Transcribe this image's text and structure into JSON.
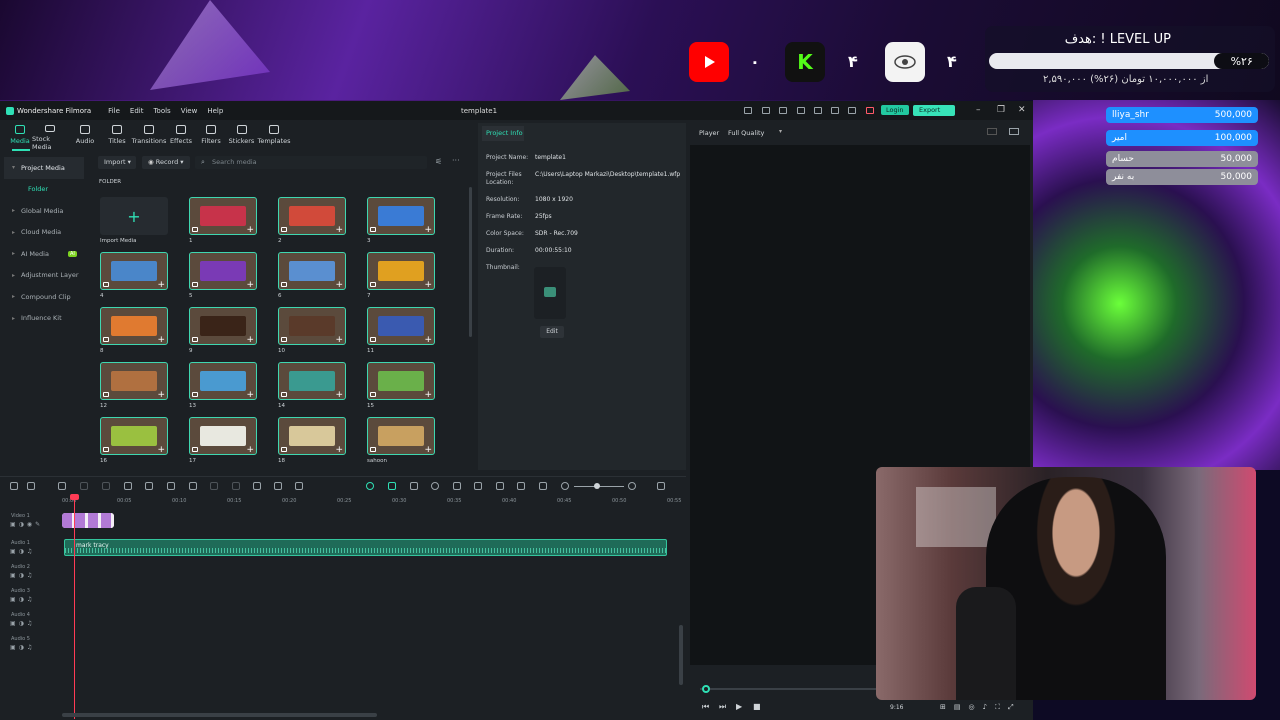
{
  "overlay": {
    "social": [
      {
        "icon": "youtube-icon",
        "count": "۰",
        "color": "#ff0000"
      },
      {
        "icon": "kick-icon",
        "count": "۴",
        "color": "#53fc18"
      },
      {
        "icon": "eye-icon",
        "count": "۴",
        "color": "#ffffff"
      }
    ],
    "goal": {
      "title": "هدف: ! LEVEL UP",
      "percent_label": "%۲۶",
      "percent": 26,
      "subtitle": "۲,۵۹۰,۰۰۰ از ۱۰,۰۰۰,۰۰۰ تومان (۲۶%)"
    },
    "donations": [
      {
        "name": "lliya_shr",
        "amount": "500,000",
        "color": "#1e90ff"
      },
      {
        "name": "امیر",
        "amount": "100,000",
        "color": "#1e90ff"
      },
      {
        "name": "حسام",
        "amount": "50,000",
        "color": "#8e8e9a"
      },
      {
        "name": "به نفر",
        "amount": "50,000",
        "color": "#8e8e9a"
      }
    ]
  },
  "app": {
    "name": "Wondershare Filmora",
    "menu": [
      "File",
      "Edit",
      "Tools",
      "View",
      "Help"
    ],
    "project_title": "template1",
    "login_label": "Login",
    "export_label": "Export"
  },
  "media_tabs": [
    {
      "label": "Media",
      "icon": "media-icon",
      "active": true
    },
    {
      "label": "Stock Media",
      "icon": "stock-media-icon"
    },
    {
      "label": "Audio",
      "icon": "music-icon"
    },
    {
      "label": "Titles",
      "icon": "text-icon"
    },
    {
      "label": "Transitions",
      "icon": "transitions-icon"
    },
    {
      "label": "Effects",
      "icon": "effects-icon"
    },
    {
      "label": "Filters",
      "icon": "filters-icon"
    },
    {
      "label": "Stickers",
      "icon": "stickers-icon"
    },
    {
      "label": "Templates",
      "icon": "templates-icon"
    }
  ],
  "sidebar": {
    "items": [
      "Project Media",
      "Folder",
      "Global Media",
      "Cloud Media",
      "AI Media",
      "Adjustment Layer",
      "Compound Clip",
      "Influence Kit"
    ],
    "ai_badge": "AI"
  },
  "media_toolbar": {
    "import_label": "Import",
    "record_label": "Record",
    "search_placeholder": "Search media",
    "folder_label": "FOLDER",
    "import_media_label": "Import Media"
  },
  "media_items": [
    {
      "label": "1",
      "color": "#c7334a"
    },
    {
      "label": "2",
      "color": "#d14a3a"
    },
    {
      "label": "3",
      "color": "#3a7bd5"
    },
    {
      "label": "4",
      "color": "#4a86c9"
    },
    {
      "label": "5",
      "color": "#7a3ab5"
    },
    {
      "label": "6",
      "color": "#5a8fd0"
    },
    {
      "label": "7",
      "color": "#e0a020"
    },
    {
      "label": "8",
      "color": "#e07a30"
    },
    {
      "label": "9",
      "color": "#3a2418"
    },
    {
      "label": "10",
      "color": "#5a3a2a"
    },
    {
      "label": "11",
      "color": "#3a5ab0"
    },
    {
      "label": "12",
      "color": "#b07040"
    },
    {
      "label": "13",
      "color": "#4a9ad0"
    },
    {
      "label": "14",
      "color": "#3a9a90"
    },
    {
      "label": "15",
      "color": "#6ab04a"
    },
    {
      "label": "16",
      "color": "#9ac040"
    },
    {
      "label": "17",
      "color": "#e8e8e0"
    },
    {
      "label": "18",
      "color": "#d8c89a"
    },
    {
      "label": "sahoon",
      "color": "#c8a060"
    }
  ],
  "project_info": {
    "tab_label": "Project Info",
    "rows": [
      {
        "label": "Project Name:",
        "value": "template1"
      },
      {
        "label": "Project Files Location:",
        "value": "C:\\Users\\Laptop Markazi\\Desktop\\template1.wfp"
      },
      {
        "label": "Resolution:",
        "value": "1080 x 1920"
      },
      {
        "label": "Frame Rate:",
        "value": "25fps"
      },
      {
        "label": "Color Space:",
        "value": "SDR - Rec.709"
      },
      {
        "label": "Duration:",
        "value": "00:00:55:10"
      },
      {
        "label": "Thumbnail:",
        "value": ""
      }
    ],
    "edit_label": "Edit"
  },
  "player": {
    "label": "Player",
    "quality": "Full Quality",
    "ratio": "9:16"
  },
  "timeline": {
    "ruler": [
      "00:00",
      "00:05",
      "00:10",
      "00:15",
      "00:20",
      "00:25",
      "00:30",
      "00:35",
      "00:40",
      "00:45",
      "00:50",
      "00:55"
    ],
    "tracks": [
      "Video 1",
      "Audio 1",
      "Audio 2",
      "Audio 3",
      "Audio 4",
      "Audio 5"
    ],
    "audio_clip_label": "mark tracy"
  }
}
